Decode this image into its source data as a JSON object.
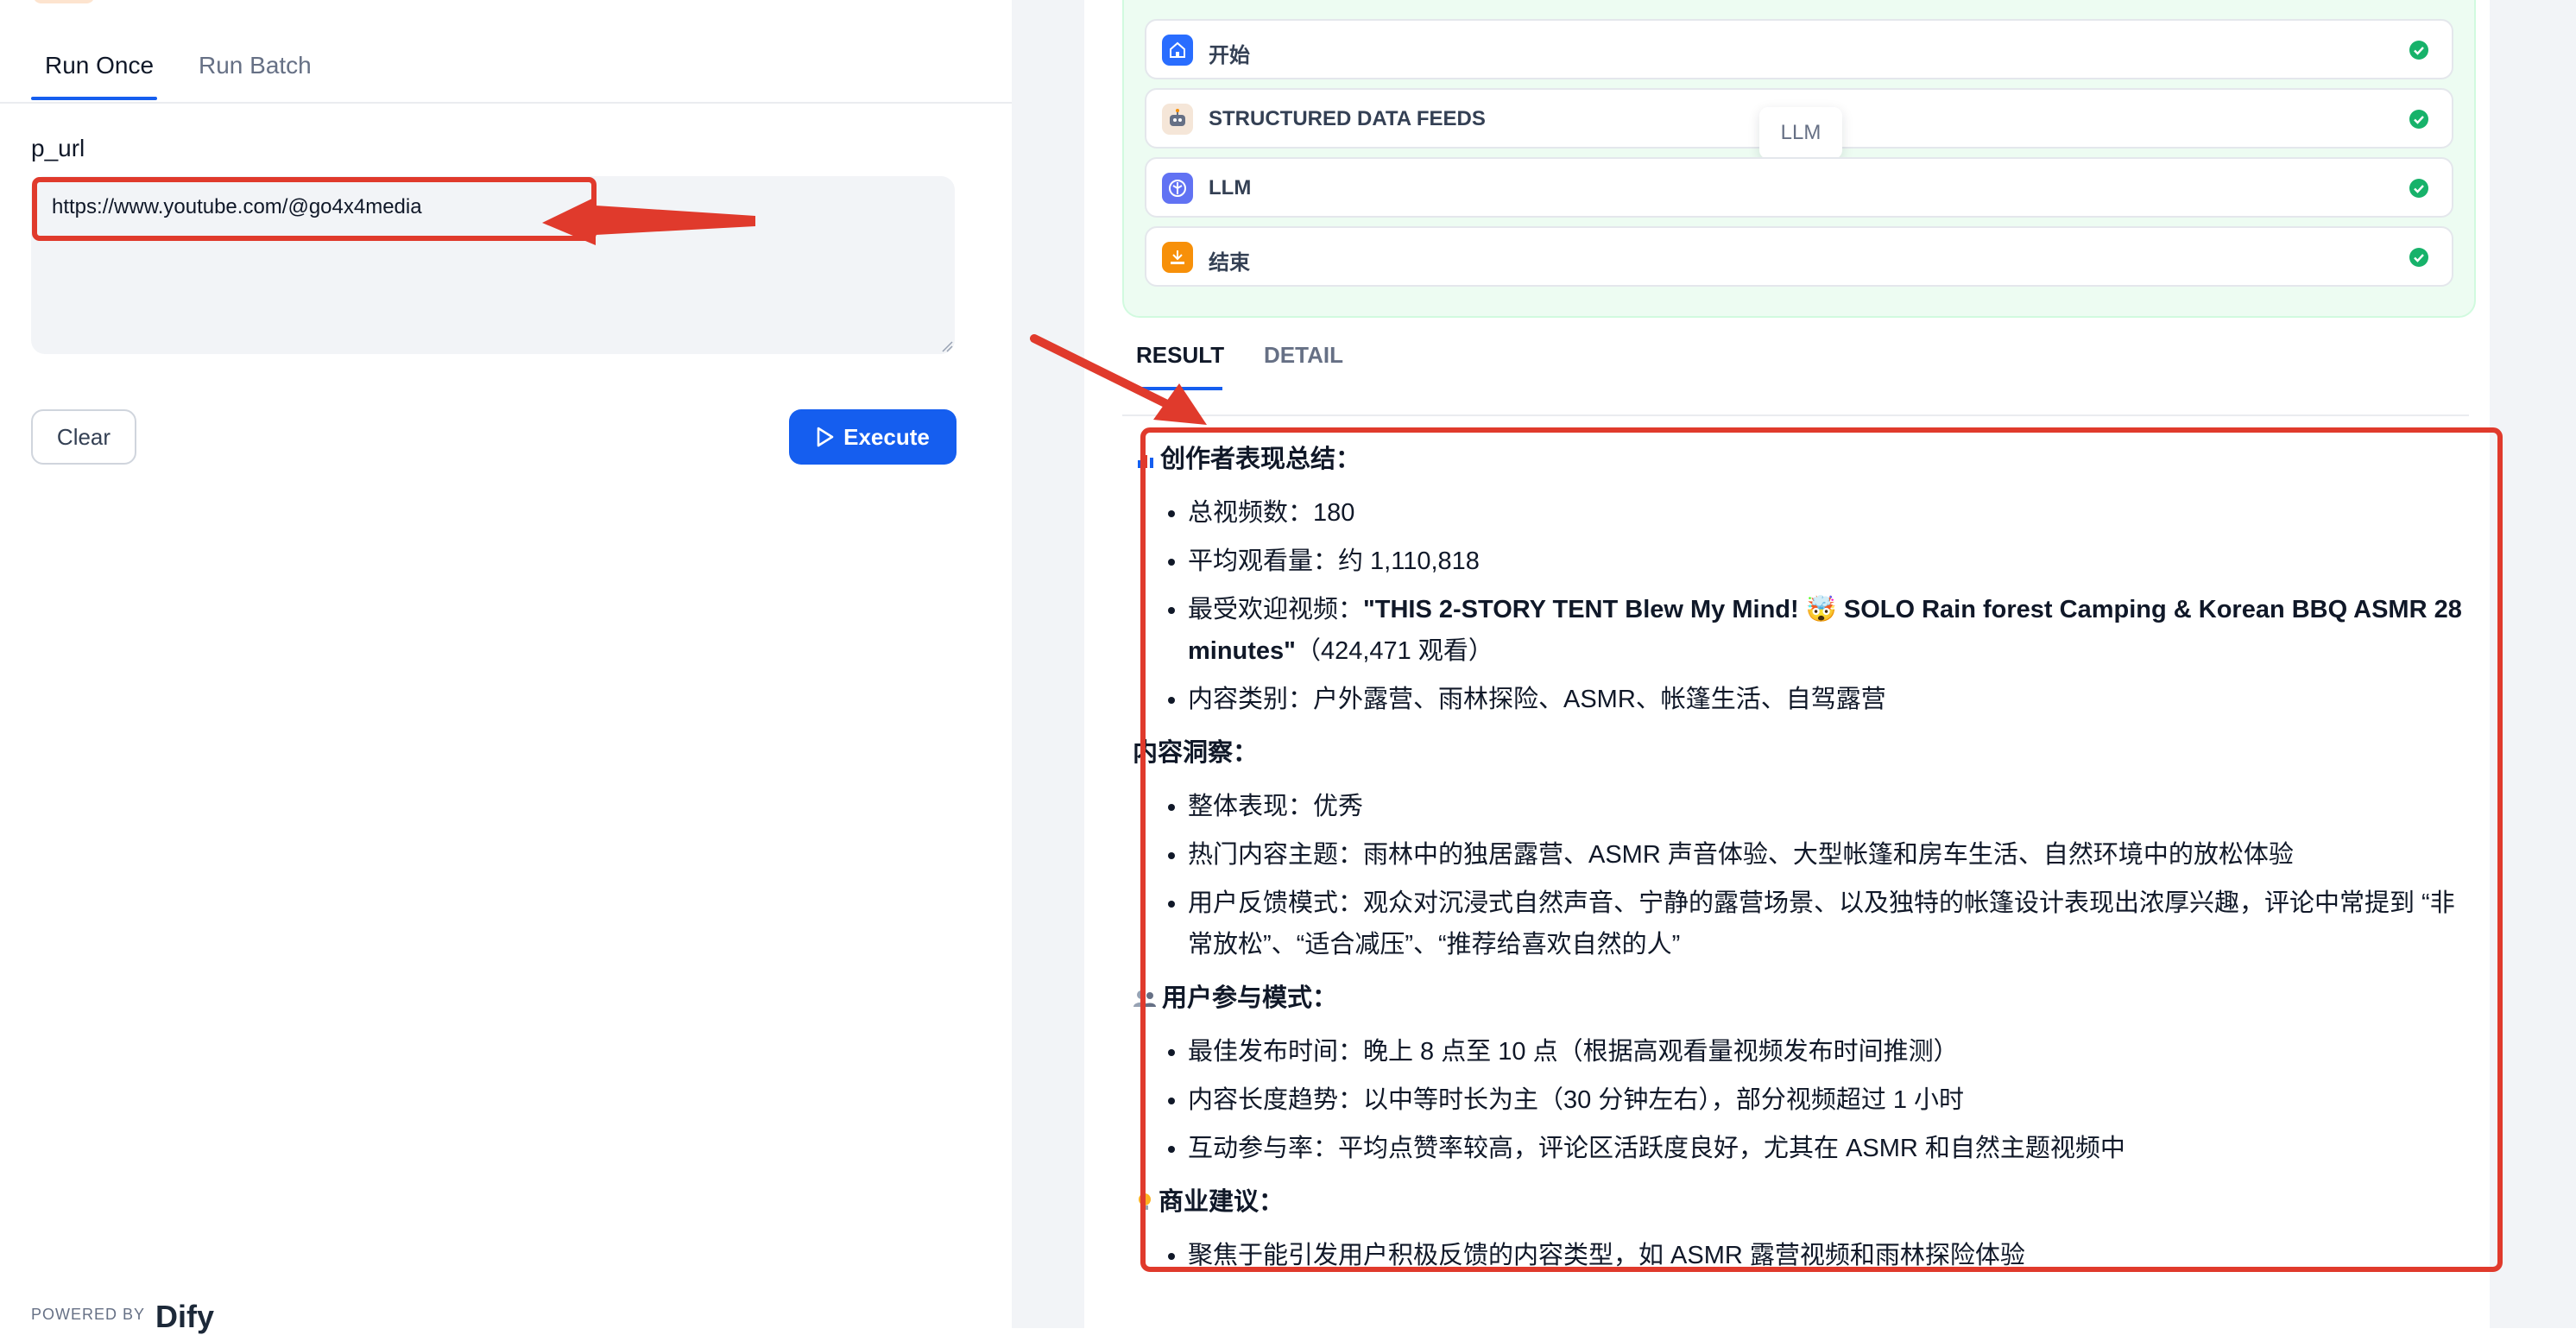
{
  "left": {
    "tabs": [
      {
        "label": "Run Once"
      },
      {
        "label": "Run Batch"
      }
    ],
    "field_label": "p_url",
    "input_value": "https://www.youtube.com/@go4x4media",
    "clear_label": "Clear",
    "execute_label": "Execute",
    "powered_by": "POWERED BY",
    "brand": "Dify"
  },
  "workflow": {
    "steps": [
      {
        "label": "开始",
        "icon": "home-icon",
        "color": "#296dff"
      },
      {
        "label": "STRUCTURED DATA FEEDS",
        "icon": "robot-icon",
        "color": "#f5e6d8"
      },
      {
        "label": "LLM",
        "icon": "llm-icon",
        "color": "#6172f3"
      },
      {
        "label": "结束",
        "icon": "end-icon",
        "color": "#f79009"
      }
    ],
    "tooltip": "LLM",
    "check_color": "#17b26a"
  },
  "result_tabs": [
    {
      "label": "RESULT"
    },
    {
      "label": "DETAIL"
    }
  ],
  "result": {
    "sec1_title": "创作者表现总结：",
    "sec1": {
      "i1": "总视频数：180",
      "i2": "平均观看量：约 1,110,818",
      "i3_prefix": "最受欢迎视频：",
      "i3_bold": "\"THIS 2-STORY TENT Blew My Mind! 🤯 SOLO Rain forest Camping & Korean BBQ ASMR 28 minutes\"",
      "i3_suffix": "（424,471 观看）",
      "i4": "内容类别：户外露营、雨林探险、ASMR、帐篷生活、自驾露营"
    },
    "sec2_title": "内容洞察：",
    "sec2": {
      "i1": "整体表现：优秀",
      "i2": "热门内容主题：雨林中的独居露营、ASMR 声音体验、大型帐篷和房车生活、自然环境中的放松体验",
      "i3": "用户反馈模式：观众对沉浸式自然声音、宁静的露营场景、以及独特的帐篷设计表现出浓厚兴趣，评论中常提到 “非常放松”、“适合减压”、“推荐给喜欢自然的人”"
    },
    "sec3_title": "用户参与模式：",
    "sec3": {
      "i1": "最佳发布时间：晚上 8 点至 10 点（根据高观看量视频发布时间推测）",
      "i2": "内容长度趋势：以中等时长为主（30 分钟左右），部分视频超过 1 小时",
      "i3": "互动参与率：平均点赞率较高，评论区活跃度良好，尤其在 ASMR 和自然主题视频中"
    },
    "sec4_title": "商业建议：",
    "sec4": {
      "i1": "聚焦于能引发用户积极反馈的内容类型，如 ASMR 露营视频和雨林探险体验"
    }
  },
  "annotation_color": "#e03a2c"
}
